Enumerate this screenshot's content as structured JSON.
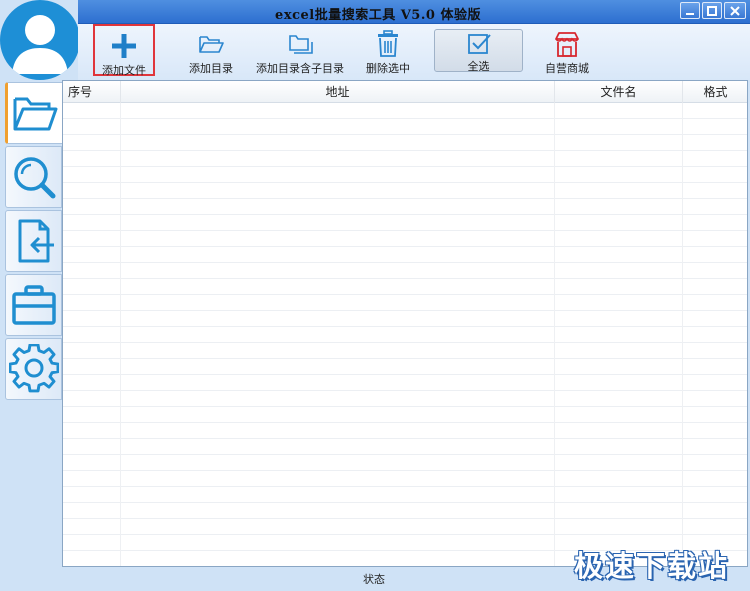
{
  "window": {
    "title": "excel批量搜索工具 V5.0 体验版"
  },
  "toolbar": {
    "add_file": "添加文件",
    "add_dir": "添加目录",
    "add_dir_sub": "添加目录含子目录",
    "delete_selected": "删除选中",
    "select_all": "全选",
    "shop": "自营商城"
  },
  "sidebar": {
    "items": [
      "folder-icon",
      "search-icon",
      "export-file-icon",
      "toolbox-icon",
      "gear-icon"
    ]
  },
  "table": {
    "columns": [
      "序号",
      "地址",
      "文件名",
      "格式"
    ],
    "rows": []
  },
  "status": {
    "label": "状态"
  },
  "watermark": {
    "text": "极速下载站"
  },
  "colors": {
    "titlebar": "#3a78d4",
    "accent_blue": "#1e8fd6",
    "selection_border": "#e0353b",
    "shop_red": "#d7262e"
  }
}
